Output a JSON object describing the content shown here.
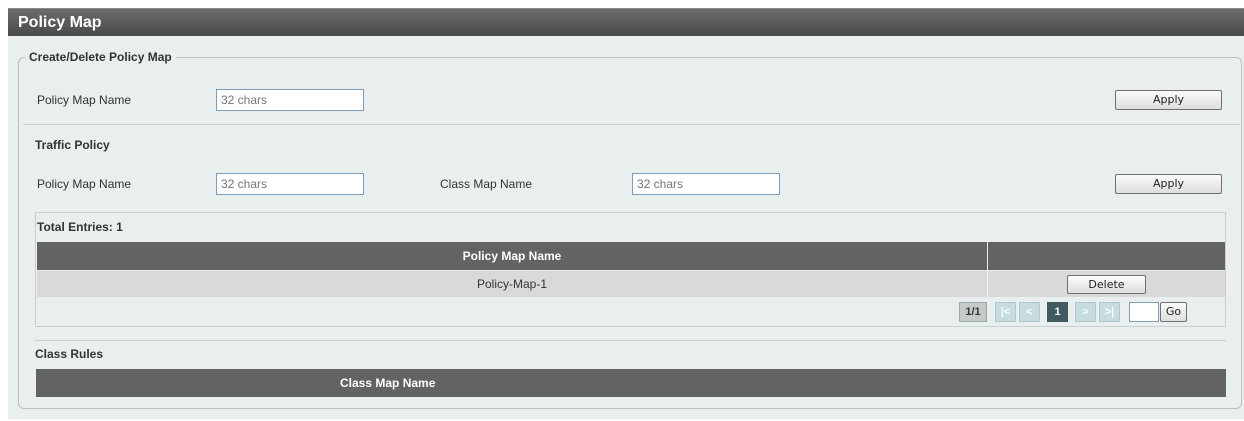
{
  "header": {
    "title": "Policy Map"
  },
  "create_delete": {
    "legend": "Create/Delete Policy Map",
    "policy_map_name_label": "Policy Map Name",
    "policy_map_name_placeholder": "32 chars",
    "apply_label": "Apply"
  },
  "traffic_policy": {
    "title": "Traffic Policy",
    "policy_map_name_label": "Policy Map Name",
    "policy_map_name_placeholder": "32 chars",
    "class_map_name_label": "Class Map Name",
    "class_map_name_placeholder": "32 chars",
    "apply_label": "Apply"
  },
  "policy_table": {
    "total_entries": "Total Entries: 1",
    "columns": [
      "Policy Map Name",
      ""
    ],
    "rows": [
      {
        "name": "Policy-Map-1",
        "action_label": "Delete"
      }
    ],
    "pager": {
      "page_indicator": "1/1",
      "first": "|<",
      "prev": "<",
      "current": "1",
      "next": ">",
      "last": ">|",
      "go_label": "Go",
      "page_input_value": ""
    }
  },
  "class_rules": {
    "title": "Class Rules",
    "columns": [
      "Class Map Name"
    ]
  },
  "colors": {
    "title_bar": "#555555",
    "panel_bg": "#e9eeee",
    "table_header": "#636363",
    "table_row": "#d9d9d9",
    "pager_active": "#3f5b5f"
  }
}
